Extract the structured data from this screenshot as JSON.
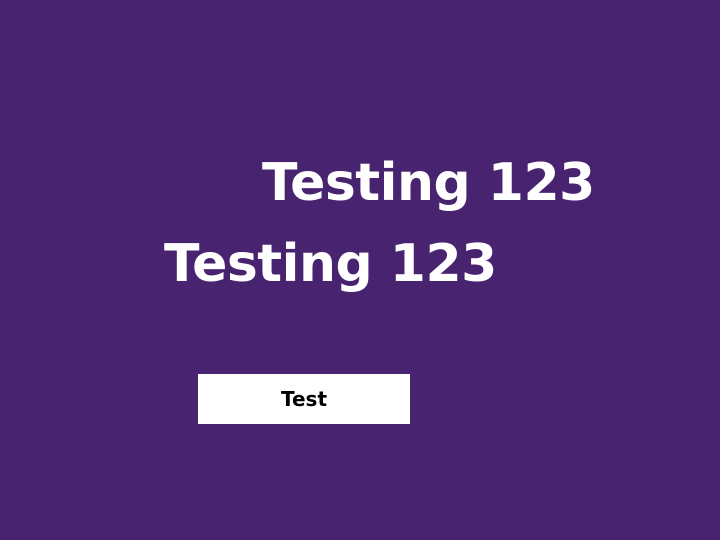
{
  "screen": {
    "background_color": "#482370",
    "text_color": "#ffffff"
  },
  "headings": [
    {
      "text": "Testing 123"
    },
    {
      "text": "Testing 123"
    }
  ],
  "button": {
    "label": "Test",
    "background_color": "#ffffff",
    "text_color": "#000000"
  }
}
